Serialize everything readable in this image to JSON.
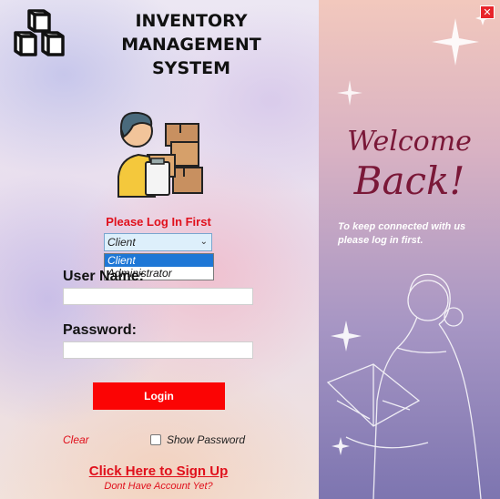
{
  "app": {
    "title_line1": "INVENTORY",
    "title_line2": "MANAGEMENT SYSTEM",
    "logo_icon": "boxes-logo-icon",
    "illustration": "person-with-boxes-illustration"
  },
  "login": {
    "prompt": "Please Log In First",
    "role_select": {
      "value": "Client",
      "options": [
        "Client",
        "Administrator"
      ],
      "highlighted": "Client"
    },
    "username_label": "User Name:",
    "username_value": "",
    "password_label": "Password:",
    "password_value": "",
    "login_button": "Login",
    "clear_link": "Clear",
    "show_password_label": "Show Password",
    "show_password_checked": false,
    "signup_link": "Click Here to Sign Up",
    "no_account_text": "Dont Have Account Yet?"
  },
  "side_panel": {
    "welcome": "Welcome",
    "back": "Back!",
    "message": "To keep connected with us please log in first.",
    "close_icon": "close-icon"
  },
  "colors": {
    "accent_red": "#e0101c",
    "login_button": "#fb0404",
    "select_highlight": "#1e77d6",
    "welcome_text": "#7a1838"
  }
}
